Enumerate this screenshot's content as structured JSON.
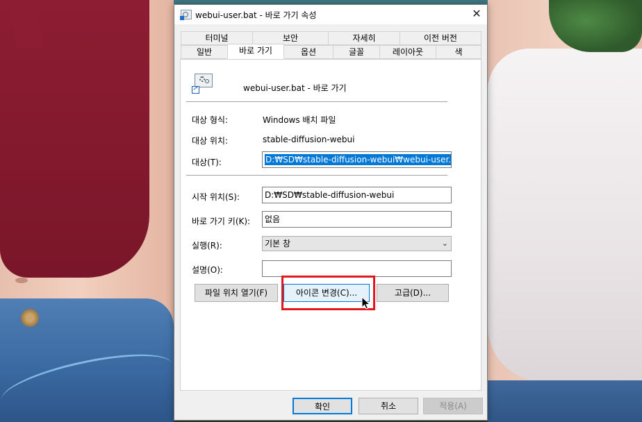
{
  "window": {
    "title": "webui-user.bat - 바로 가기 속성",
    "close_symbol": "✕"
  },
  "tabs": {
    "row1": [
      "터미널",
      "보안",
      "자세히",
      "이전 버전"
    ],
    "row2": [
      "일반",
      "바로 가기",
      "옵션",
      "글꼴",
      "레이아웃",
      "색"
    ],
    "active": "바로 가기"
  },
  "shortcut": {
    "name": "webui-user.bat - 바로 가기",
    "icon": "shortcut-bat-icon"
  },
  "fields": {
    "target_type_label": "대상 형식:",
    "target_type_value": "Windows 배치 파일",
    "target_location_label": "대상 위치:",
    "target_location_value": "stable-diffusion-webui",
    "target_label": "대상(T):",
    "target_value": "D:₩SD₩stable-diffusion-webui₩webui-user.bat",
    "start_in_label": "시작 위치(S):",
    "start_in_value": "D:₩SD₩stable-diffusion-webui",
    "hotkey_label": "바로 가기 키(K):",
    "hotkey_value": "없음",
    "run_label": "실행(R):",
    "run_value": "기본 창",
    "comment_label": "설명(O):",
    "comment_value": ""
  },
  "buttons": {
    "open_location": "파일 위치 열기(F)",
    "change_icon": "아이콘 변경(C)...",
    "advanced": "고급(D)...",
    "ok": "확인",
    "cancel": "취소",
    "apply": "적용(A)"
  },
  "colors": {
    "selection": "#0078d7",
    "highlight_box": "#e2161d",
    "title_bar_bg": "#ffffff",
    "dialog_bg": "#f0f0f0"
  }
}
